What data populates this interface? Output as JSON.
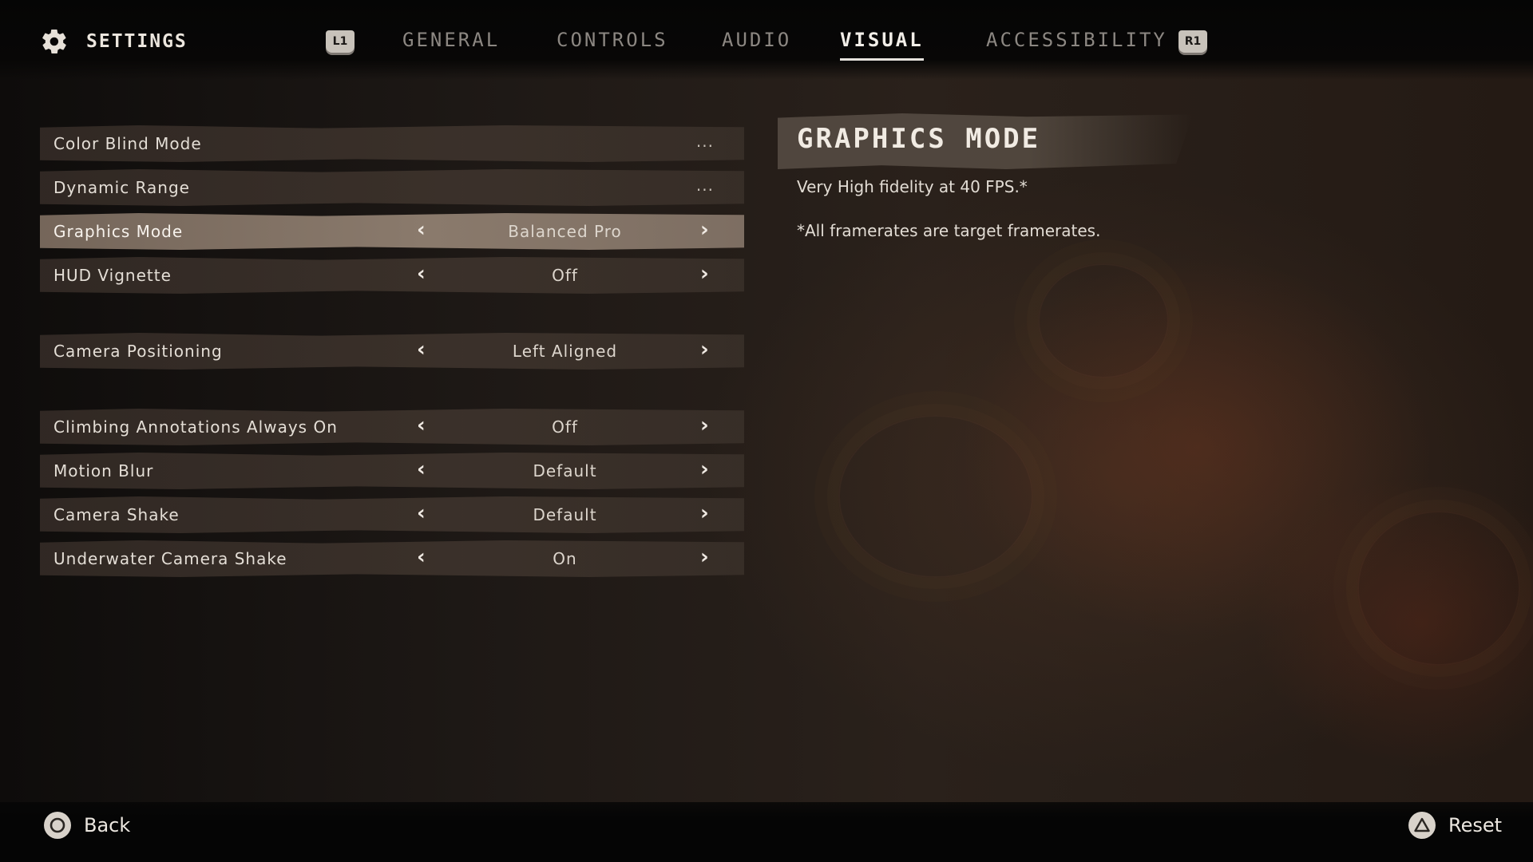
{
  "header": {
    "title": "SETTINGS",
    "left_button": "L1",
    "right_button": "R1",
    "tabs": [
      {
        "label": "GENERAL",
        "active": false
      },
      {
        "label": "CONTROLS",
        "active": false
      },
      {
        "label": "AUDIO",
        "active": false
      },
      {
        "label": "VISUAL",
        "active": true
      },
      {
        "label": "ACCESSIBILITY",
        "active": false
      }
    ]
  },
  "settings": [
    {
      "label": "Color Blind Mode",
      "value": "...",
      "type": "submenu"
    },
    {
      "label": "Dynamic Range",
      "value": "...",
      "type": "submenu"
    },
    {
      "label": "Graphics Mode",
      "value": "Balanced Pro",
      "type": "selector",
      "selected": true
    },
    {
      "label": "HUD Vignette",
      "value": "Off",
      "type": "selector"
    },
    {
      "label": "Camera Positioning",
      "value": "Left Aligned",
      "type": "selector"
    },
    {
      "label": "Climbing Annotations Always On",
      "value": "Off",
      "type": "selector"
    },
    {
      "label": "Motion Blur",
      "value": "Default",
      "type": "selector"
    },
    {
      "label": "Camera Shake",
      "value": "Default",
      "type": "selector"
    },
    {
      "label": "Underwater Camera Shake",
      "value": "On",
      "type": "selector"
    }
  ],
  "info": {
    "title": "GRAPHICS MODE",
    "description": "Very High fidelity at 40 FPS.*",
    "note": "*All framerates are target framerates."
  },
  "footer": {
    "back_label": "Back",
    "back_icon": "circle-button-icon",
    "reset_label": "Reset",
    "reset_icon": "triangle-button-icon"
  },
  "colors": {
    "selected_row": "#8a7a6c",
    "row": "#3a302a",
    "text": "#e6e0d8"
  }
}
